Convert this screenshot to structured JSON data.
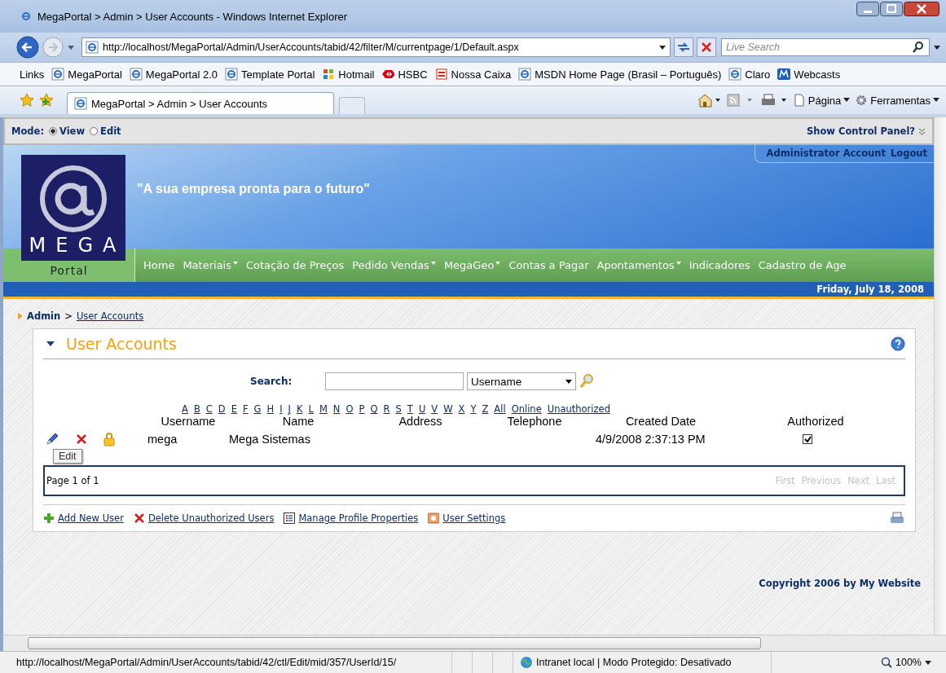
{
  "window": {
    "title": "MegaPortal > Admin > User Accounts - Windows Internet Explorer"
  },
  "address_bar": {
    "url": "http://localhost/MegaPortal/Admin/UserAccounts/tabid/42/filter/M/currentpage/1/Default.aspx"
  },
  "search": {
    "placeholder": "Live Search"
  },
  "links_bar": {
    "label": "Links",
    "items": [
      {
        "label": "MegaPortal",
        "kind": "ie"
      },
      {
        "label": "MegaPortal 2.0",
        "kind": "ie"
      },
      {
        "label": "Template Portal",
        "kind": "ie"
      },
      {
        "label": "Hotmail",
        "kind": "flag"
      },
      {
        "label": "HSBC",
        "kind": "hsbc"
      },
      {
        "label": "Nossa Caixa",
        "kind": "caixa"
      },
      {
        "label": "MSDN Home Page (Brasil – Português)",
        "kind": "ie"
      },
      {
        "label": "Claro",
        "kind": "ie"
      },
      {
        "label": "Webcasts",
        "kind": "msdn"
      }
    ]
  },
  "tabs": [
    {
      "label": "MegaPortal > Admin > User Accounts",
      "selected": true
    }
  ],
  "command_bar": [
    {
      "label": "Página"
    },
    {
      "label": "Ferramentas"
    }
  ],
  "control_bar": {
    "label": "Mode:",
    "modes": [
      {
        "label": "View",
        "selected": true
      },
      {
        "label": "Edit",
        "selected": false
      }
    ],
    "show_panel": "Show Control Panel?"
  },
  "header": {
    "account": "Administrator Account",
    "logout": "Logout",
    "logo_word": "MEGA",
    "logo_sub": "Portal",
    "slogan": "\"A sua empresa pronta para o futuro\""
  },
  "nav": [
    {
      "label": "Home",
      "dropdown": false
    },
    {
      "label": "Materiais",
      "dropdown": true
    },
    {
      "label": "Cotação de Preços",
      "dropdown": false
    },
    {
      "label": "Pedido Vendas",
      "dropdown": true
    },
    {
      "label": "MegaGeo",
      "dropdown": true
    },
    {
      "label": "Contas a Pagar",
      "dropdown": false
    },
    {
      "label": "Apontamentos",
      "dropdown": true
    },
    {
      "label": "Indicadores",
      "dropdown": false
    },
    {
      "label": "Cadastro de Age",
      "dropdown": false
    }
  ],
  "date": "Friday, July 18, 2008",
  "breadcrumb": {
    "root": "Admin",
    "separator": ">",
    "current": "User Accounts"
  },
  "module": {
    "title": "User Accounts",
    "search": {
      "label": "Search:",
      "filter": "Username"
    },
    "letters": [
      "A",
      "B",
      "C",
      "D",
      "E",
      "F",
      "G",
      "H",
      "I",
      "J",
      "K",
      "L",
      "M",
      "N",
      "O",
      "P",
      "Q",
      "R",
      "S",
      "T",
      "U",
      "V",
      "W",
      "X",
      "Y",
      "Z",
      "All",
      "Online",
      "Unauthorized"
    ],
    "columns": [
      "Username",
      "Name",
      "Address",
      "Telephone",
      "Created Date",
      "Authorized"
    ],
    "rows": [
      {
        "username": "mega",
        "name": "Mega Sistemas",
        "created": "4/9/2008 2:37:13 PM",
        "authorized": true
      }
    ],
    "tooltip": "Edit",
    "pager": {
      "info": "Page 1 of 1",
      "links": [
        {
          "label": "First",
          "disabled": true
        },
        {
          "label": "Previous",
          "disabled": true
        },
        {
          "label": "Next",
          "disabled": true
        },
        {
          "label": "Last",
          "disabled": true
        }
      ]
    },
    "actions": [
      {
        "label": "Add New User",
        "kind": "plus"
      },
      {
        "label": "Delete Unauthorized Users",
        "kind": "x"
      },
      {
        "label": "Manage Profile Properties",
        "kind": "list"
      },
      {
        "label": "User Settings",
        "kind": "settings"
      }
    ]
  },
  "footer": {
    "copyright": "Copyright 2006 by My Website"
  },
  "status_bar": {
    "url": "http://localhost/MegaPortal/Admin/UserAccounts/tabid/42/ctl/Edit/mid/357/UserId/15/",
    "zone": "Intranet local | Modo Protegido: Desativado",
    "zoom": "100%"
  }
}
